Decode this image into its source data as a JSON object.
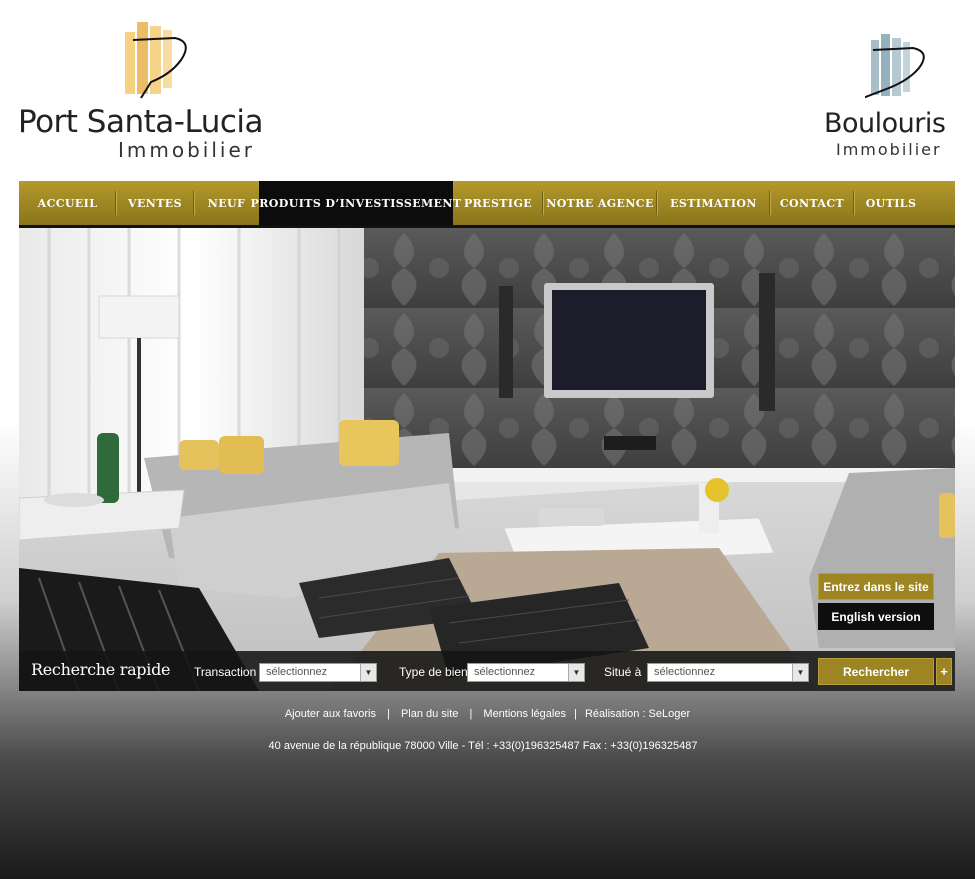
{
  "brand_left": {
    "title": "Port Santa-Lucia",
    "subtitle": "Immobilier"
  },
  "brand_right": {
    "title": "Boulouris",
    "subtitle": "Immobilier"
  },
  "nav": {
    "items": [
      {
        "label": "ACCUEIL"
      },
      {
        "label": "VENTES"
      },
      {
        "label": "NEUF"
      },
      {
        "label": "PRODUITS D’INVESTISSEMENT",
        "active": true
      },
      {
        "label": "PRESTIGE"
      },
      {
        "label": "NOTRE AGENCE"
      },
      {
        "label": "ESTIMATION"
      },
      {
        "label": "CONTACT"
      },
      {
        "label": "OUTILS"
      }
    ]
  },
  "hero": {
    "enter_label": "Entrez dans le site",
    "english_label": "English version"
  },
  "search": {
    "title": "Recherche rapide",
    "transaction_label": "Transaction",
    "transaction_value": "sélectionnez",
    "type_label": "Type de bien",
    "type_value": "sélectionnez",
    "location_label": "Situé à",
    "location_value": "sélectionnez",
    "submit_label": "Rechercher",
    "plus_label": "+"
  },
  "footer": {
    "links": [
      "Ajouter aux favoris",
      "Plan du site",
      "Mentions légales",
      "Réalisation : SeLoger"
    ],
    "separator": "|",
    "address": "40 avenue de la république  78000 Ville   -   Tél : +33(0)196325487 Fax : +33(0)196325487"
  },
  "colors": {
    "gold": "#9c8522",
    "dark": "#0e0e0e"
  }
}
